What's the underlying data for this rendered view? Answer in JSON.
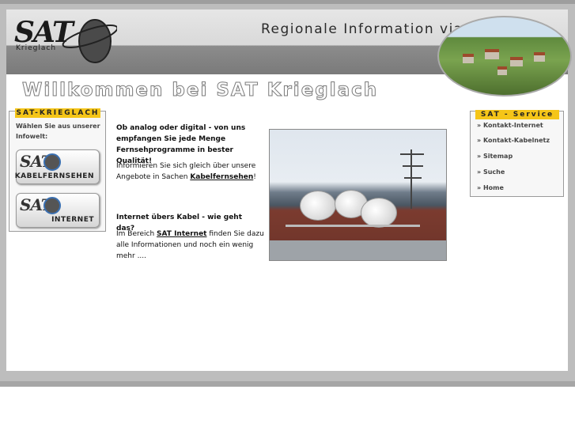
{
  "header": {
    "logo_text": "SAT",
    "logo_sub": "Krieglach",
    "slogan": "Regionale Information via Bildschirm"
  },
  "welcome": "Willkommen bei SAT Krieglach",
  "left_box": {
    "title": "SAT-KRIEGLACH",
    "intro": "Wählen Sie aus unserer Infowelt:",
    "buttons": [
      {
        "logo": "SAT",
        "label": "KABELFERNSEHEN"
      },
      {
        "logo": "SAT",
        "label": "INTERNET"
      }
    ]
  },
  "content": {
    "block1_heading": "Ob analog oder digital - von uns empfangen Sie jede Menge Fernsehprogramme in bester Qualität!",
    "block1_text_before": "Informieren Sie sich gleich über unsere Angebote in Sachen ",
    "block1_link": "Kabelfernsehen",
    "block1_text_after": "!",
    "block2_heading": "Internet übers Kabel - wie geht das?",
    "block2_text_before": "Im Bereich ",
    "block2_link": "SAT Internet",
    "block2_text_after": " finden Sie dazu alle Informationen und noch ein wenig mehr ...."
  },
  "service": {
    "title": "SAT - Service",
    "items": [
      "» Kontakt-Internet",
      "» Kontakt-Kabelnetz",
      "» Sitemap",
      "» Suche",
      "» Home"
    ]
  },
  "colors": {
    "accent": "#f5c518",
    "frame": "#bdbdbd",
    "header_dark": "#7a7a7a"
  }
}
